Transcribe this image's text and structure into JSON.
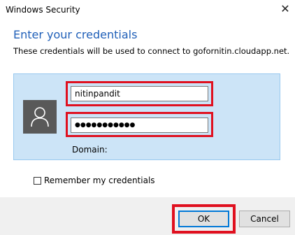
{
  "window": {
    "title": "Windows Security"
  },
  "dialog": {
    "heading": "Enter your credentials",
    "subtext": "These credentials will be used to connect to gofornitin.cloudapp.net."
  },
  "fields": {
    "username_value": "nitinpandit",
    "password_value": "●●●●●●●●●●●",
    "domain_label": "Domain:"
  },
  "options": {
    "remember_label": "Remember my credentials"
  },
  "buttons": {
    "ok_label": "OK",
    "cancel_label": "Cancel"
  },
  "icons": {
    "close": "close-icon",
    "avatar": "user-avatar-icon"
  },
  "colors": {
    "accent": "#1f5fb8",
    "highlight": "#e0101f",
    "panel": "#cce4f7"
  }
}
